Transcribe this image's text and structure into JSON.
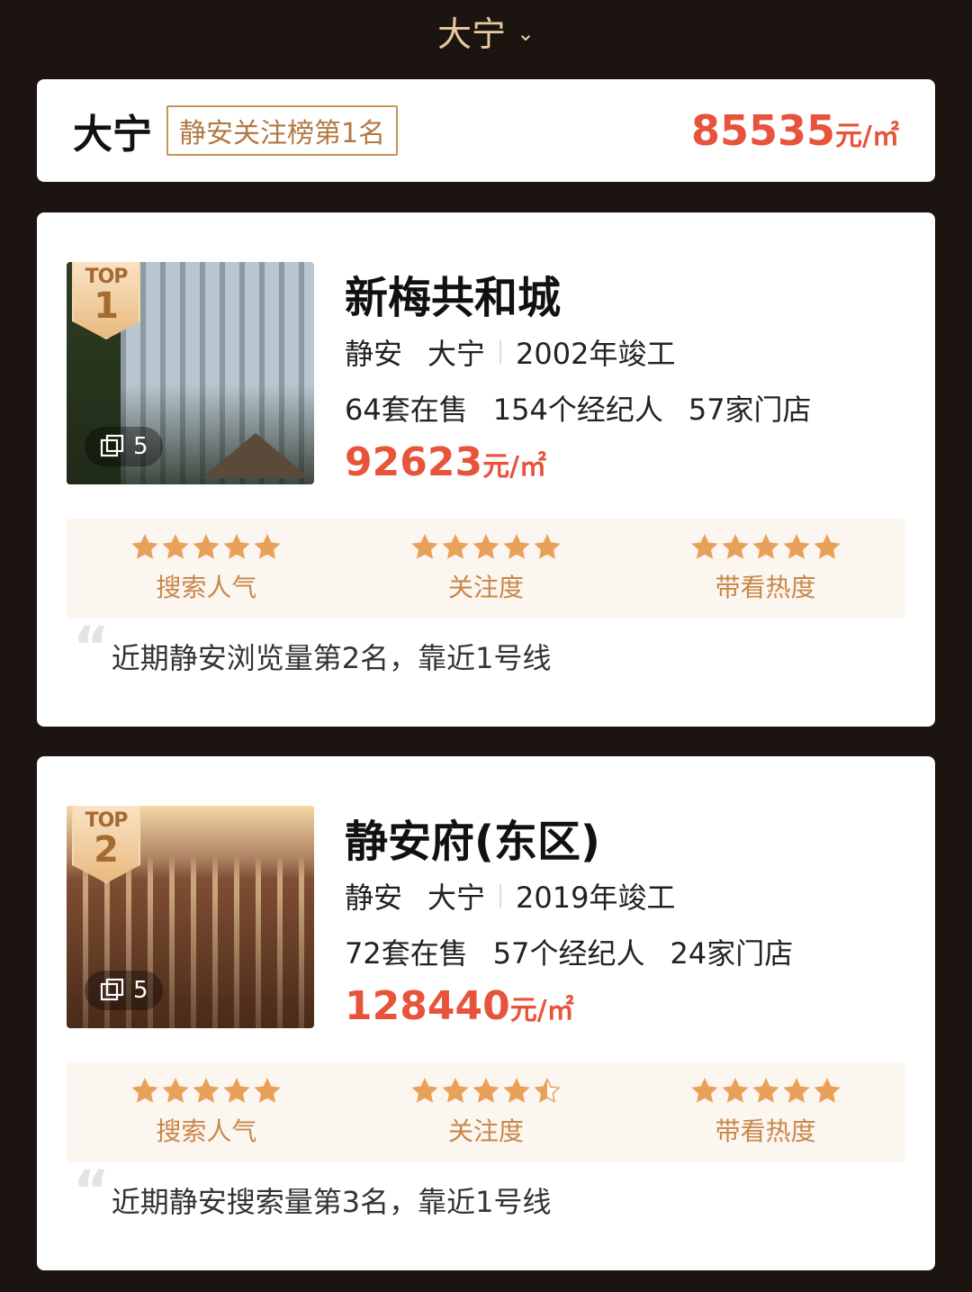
{
  "header": {
    "title": "大宁",
    "chevron_icon": "chevron-down-icon"
  },
  "summary": {
    "district": "大宁",
    "rank_tag": "静安关注榜第1名",
    "price_value": "85535",
    "price_unit": "元/㎡"
  },
  "colors": {
    "accent_red": "#e8533b",
    "gold": "#c8874a",
    "star_color": "#e9a15a"
  },
  "listings": [
    {
      "badge_top": "TOP",
      "badge_num": "1",
      "photo_count": "5",
      "name": "新梅共和城",
      "area1": "静安",
      "area2": "大宁",
      "completed": "2002年竣工",
      "on_sale": "64套在售",
      "agents": "154个经纪人",
      "stores": "57家门店",
      "price_value": "92623",
      "price_unit": "元/㎡",
      "ratings": [
        {
          "label": "搜索人气",
          "stars": 5
        },
        {
          "label": "关注度",
          "stars": 5
        },
        {
          "label": "带看热度",
          "stars": 5
        }
      ],
      "quote": "近期静安浏览量第2名，靠近1号线"
    },
    {
      "badge_top": "TOP",
      "badge_num": "2",
      "photo_count": "5",
      "name": "静安府(东区)",
      "area1": "静安",
      "area2": "大宁",
      "completed": "2019年竣工",
      "on_sale": "72套在售",
      "agents": "57个经纪人",
      "stores": "24家门店",
      "price_value": "128440",
      "price_unit": "元/㎡",
      "ratings": [
        {
          "label": "搜索人气",
          "stars": 5
        },
        {
          "label": "关注度",
          "stars": 4.5
        },
        {
          "label": "带看热度",
          "stars": 5
        }
      ],
      "quote": "近期静安搜索量第3名，靠近1号线"
    }
  ]
}
